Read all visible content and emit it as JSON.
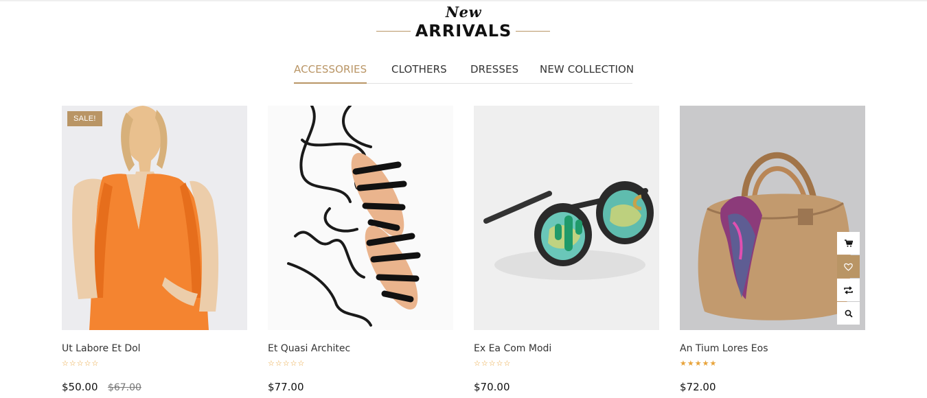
{
  "heading": {
    "script": "New",
    "title": "ARRIVALS"
  },
  "tabs": [
    {
      "label": "ACCESSORIES",
      "active": true
    },
    {
      "label": "CLOTHERS",
      "active": false
    },
    {
      "label": "DRESSES",
      "active": false
    },
    {
      "label": "NEW COLLECTION",
      "active": false
    }
  ],
  "colors": {
    "accent": "#b99565",
    "star": "#e8a33a"
  },
  "products": [
    {
      "name": "Ut Labore Et Dol",
      "price": "$50.00",
      "old_price": "$67.00",
      "badge": "SALE!",
      "rating": 0,
      "stars": "☆☆☆☆☆"
    },
    {
      "name": "Et Quasi Architec",
      "price": "$77.00",
      "rating": 0,
      "stars": "☆☆☆☆☆"
    },
    {
      "name": "Ex Ea Com Modi",
      "price": "$70.00",
      "rating": 0,
      "stars": "☆☆☆☆☆"
    },
    {
      "name": "An Tium Lores Eos",
      "price": "$72.00",
      "rating": 5,
      "stars": "★★★★★"
    }
  ],
  "product_actions": [
    {
      "icon": "cart-icon"
    },
    {
      "icon": "heart-icon"
    },
    {
      "icon": "compare-icon"
    },
    {
      "icon": "search-icon"
    }
  ]
}
